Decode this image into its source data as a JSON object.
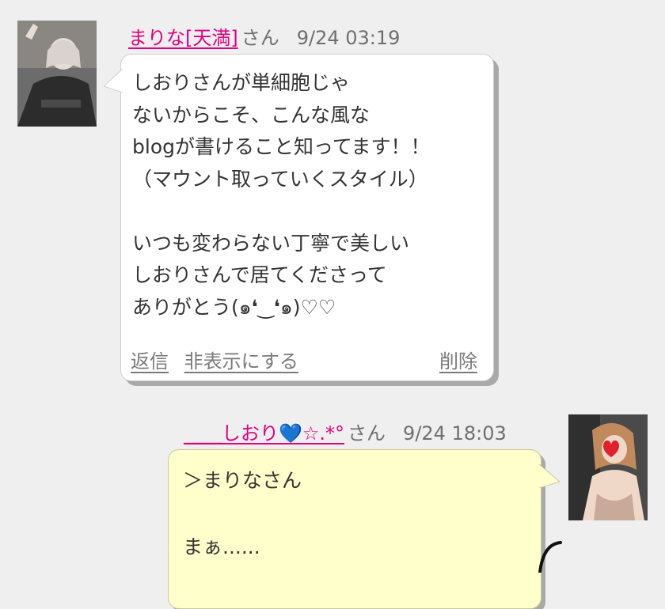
{
  "messages": [
    {
      "sender": "まりな[天満]",
      "honorific": "さん",
      "time": "9/24 03:19",
      "body": "しおりさんが単細胞じゃ\nないからこそ、こんな風な\nblogが書けること知ってます！！\n（マウント取っていくスタイル）\n\nいつも変わらない丁寧で美しい\nしおりさんで居てくださって\nありがとう(๑❛‿❛๑)♡♡",
      "actions": {
        "reply": "返信",
        "hide": "非表示にする",
        "delete": "削除"
      }
    },
    {
      "sender_prefix": "____しおり",
      "sender_heart": "💙",
      "sender_suffix": "☆.*°",
      "honorific": "さん",
      "time": "9/24 18:03",
      "body": "＞まりなさん\n\nまぁ......"
    }
  ],
  "colors": {
    "background": "#efefef",
    "name_link": "#e4007f",
    "bubble_other": "#ffffff",
    "bubble_self": "#ffffcc"
  }
}
